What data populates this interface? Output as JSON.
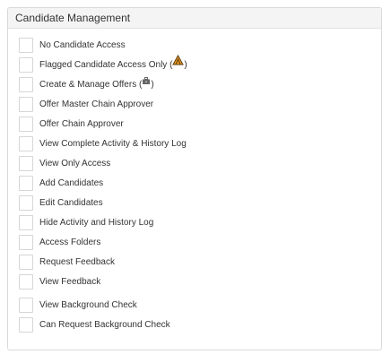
{
  "panel": {
    "title": "Candidate Management"
  },
  "permissions": [
    {
      "label": "No Candidate Access"
    },
    {
      "label": "Flagged Candidate Access Only (",
      "suffix": ")",
      "icon": "flag-icon"
    },
    {
      "label": "Create & Manage Offers (",
      "suffix": ")",
      "icon": "briefcase-icon"
    },
    {
      "label": "Offer Master Chain Approver"
    },
    {
      "label": "Offer Chain Approver"
    },
    {
      "label": "View Complete Activity & History Log"
    },
    {
      "label": "View Only Access"
    },
    {
      "label": "Add Candidates"
    },
    {
      "label": "Edit Candidates"
    },
    {
      "label": "Hide Activity and History Log"
    },
    {
      "label": "Access Folders"
    },
    {
      "label": "Request Feedback"
    },
    {
      "label": "View Feedback"
    },
    {
      "label": "View Background Check"
    },
    {
      "label": "Can Request Background Check"
    }
  ],
  "colors": {
    "flag_orange": "#f0a020",
    "flag_outline": "#5a3a10",
    "briefcase": "#666666"
  }
}
